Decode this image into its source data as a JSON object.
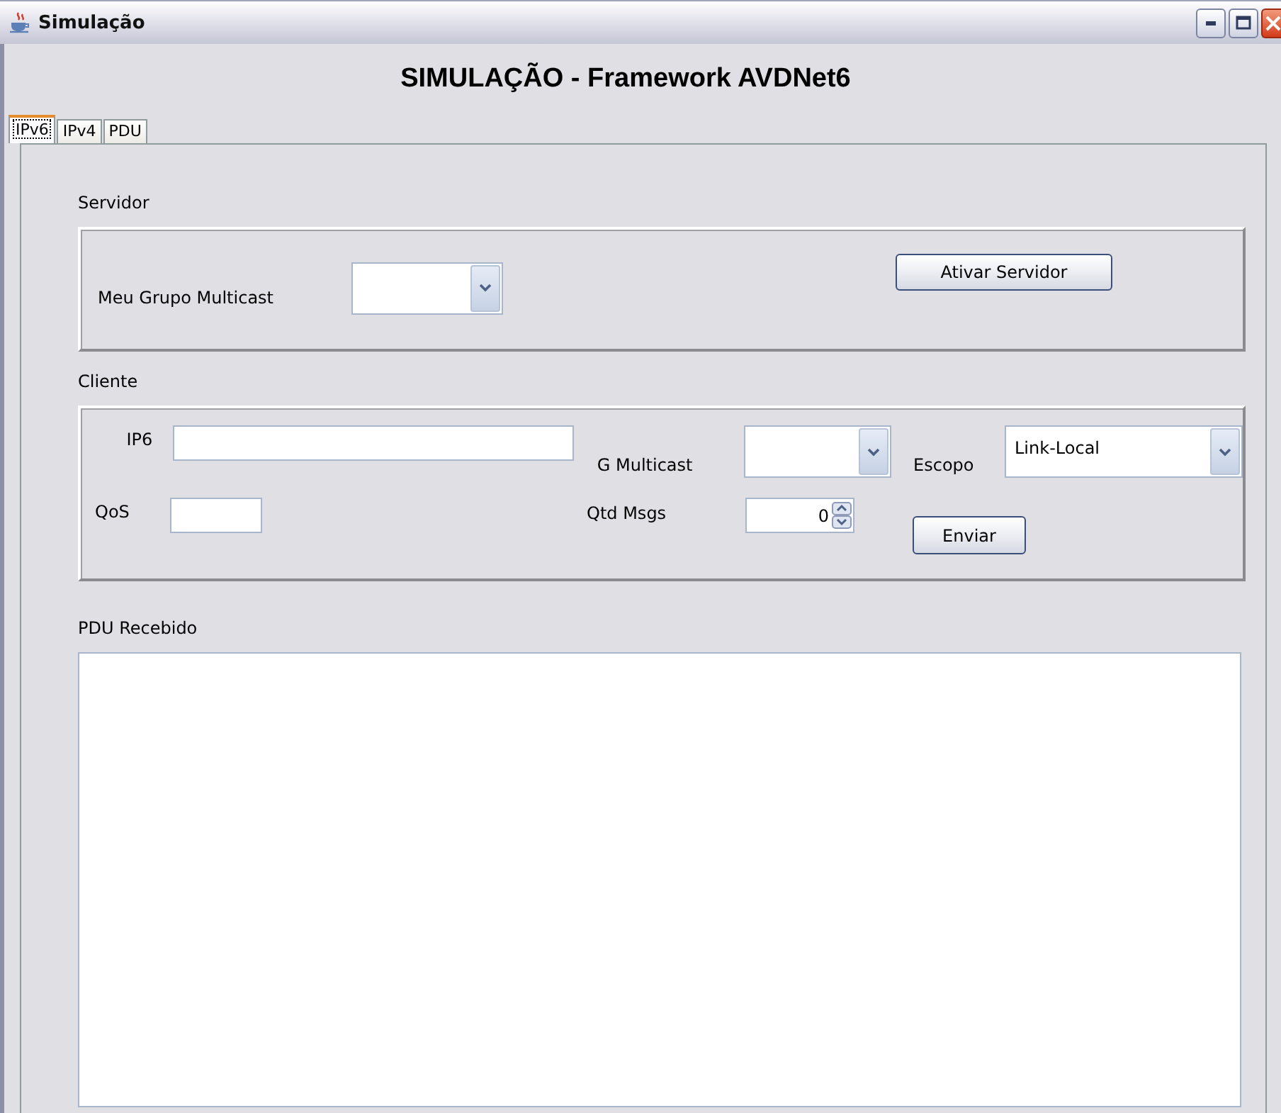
{
  "window": {
    "title": "Simulação"
  },
  "heading": "SIMULAÇÃO - Framework AVDNet6",
  "tabs": [
    {
      "label": "IPv6",
      "selected": true
    },
    {
      "label": "IPv4",
      "selected": false
    },
    {
      "label": "PDU",
      "selected": false
    }
  ],
  "servidor": {
    "label": "Servidor",
    "group_label": "Meu Grupo Multicast",
    "button": "Ativar Servidor"
  },
  "cliente": {
    "label": "Cliente",
    "ip6_label": "IP6",
    "g_multicast_label": "G Multicast",
    "escopo_label": "Escopo",
    "escopo_value": "Link-Local",
    "qos_label": "QoS",
    "qtd_label": "Qtd Msgs",
    "qtd_value": "0",
    "button": "Enviar"
  },
  "pdu": {
    "label": "PDU Recebido"
  }
}
